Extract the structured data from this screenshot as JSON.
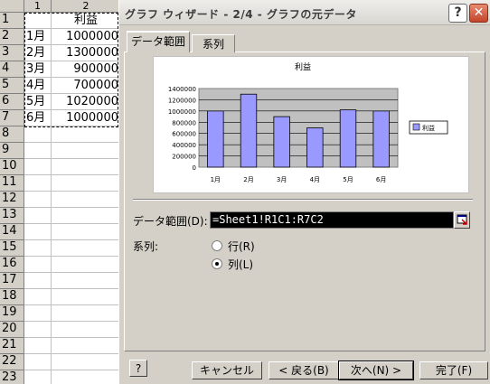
{
  "sheet": {
    "col_headers": [
      "1",
      "2"
    ],
    "row_numbers": [
      "1",
      "2",
      "3",
      "4",
      "5",
      "6",
      "7",
      "8",
      "9",
      "10",
      "11",
      "12",
      "13",
      "14",
      "15",
      "16",
      "17",
      "18",
      "19",
      "20",
      "21",
      "22",
      "23"
    ],
    "rows": [
      {
        "c1": "",
        "c2": "利益"
      },
      {
        "c1": "1月",
        "c2": "1000000"
      },
      {
        "c1": "2月",
        "c2": "1300000"
      },
      {
        "c1": "3月",
        "c2": "900000"
      },
      {
        "c1": "4月",
        "c2": "700000"
      },
      {
        "c1": "5月",
        "c2": "1020000"
      },
      {
        "c1": "6月",
        "c2": "1000000"
      }
    ]
  },
  "dialog": {
    "title": "グラフ ウィザード - 2/4 - グラフの元データ",
    "help_label": "?",
    "close_label": "✕",
    "tabs": [
      {
        "label": "データ範囲"
      },
      {
        "label": "系列"
      }
    ],
    "range_label": "データ範囲(D):",
    "range_value": "=Sheet1!R1C1:R7C2",
    "series_label": "系列:",
    "series_options": [
      {
        "label": "行(R)",
        "selected": false
      },
      {
        "label": "列(L)",
        "selected": true
      }
    ],
    "assist_label": "?",
    "buttons": {
      "cancel": "キャンセル",
      "back": "< 戻る(B)",
      "next": "次へ(N) >",
      "finish": "完了(F)"
    }
  },
  "chart_data": {
    "type": "bar",
    "title": "利益",
    "categories": [
      "1月",
      "2月",
      "3月",
      "4月",
      "5月",
      "6月"
    ],
    "series": [
      {
        "name": "利益",
        "values": [
          1000000,
          1300000,
          900000,
          700000,
          1020000,
          1000000
        ]
      }
    ],
    "yticks": [
      0,
      200000,
      400000,
      600000,
      800000,
      1000000,
      1200000,
      1400000
    ],
    "ylim": [
      0,
      1400000
    ],
    "grid": true,
    "legend": "right",
    "colors": {
      "bar": "#9999ff",
      "plot_bg": "#c0c0c0"
    }
  }
}
